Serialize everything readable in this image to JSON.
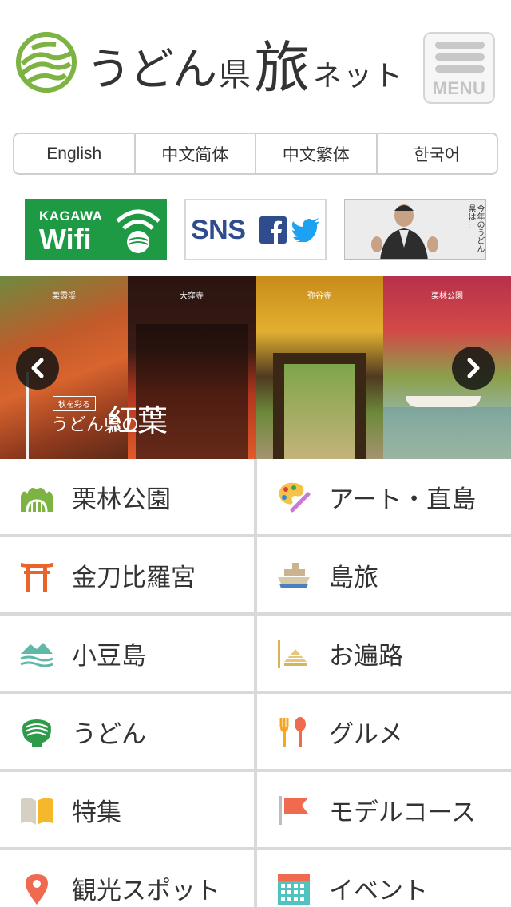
{
  "header": {
    "title_part1": "うどん",
    "title_part2": "県",
    "title_part3": "旅",
    "title_part4": "ネット",
    "menu_label": "MENU"
  },
  "languages": [
    "English",
    "中文简体",
    "中文繁体",
    "한국어"
  ],
  "banners": {
    "wifi_line1": "KAGAWA",
    "wifi_line2": "Wifi",
    "sns_text": "SNS",
    "promo_text": "今年のうどん県は…"
  },
  "slider": {
    "captions": [
      "栗霞渓",
      "大窪寺",
      "弥谷寺",
      "栗林公園"
    ],
    "title_small": "秋を彩る",
    "title_mid": "うどん県の",
    "title_big": "紅葉"
  },
  "menu_items": [
    {
      "label": "栗林公園",
      "icon": "ritsurin-park-icon"
    },
    {
      "label": "アート・直島",
      "icon": "art-palette-icon"
    },
    {
      "label": "金刀比羅宮",
      "icon": "torii-gate-icon"
    },
    {
      "label": "島旅",
      "icon": "ferry-ship-icon"
    },
    {
      "label": "小豆島",
      "icon": "island-waves-icon"
    },
    {
      "label": "お遍路",
      "icon": "pilgrim-hat-icon"
    },
    {
      "label": "うどん",
      "icon": "udon-bowl-icon"
    },
    {
      "label": "グルメ",
      "icon": "fork-spoon-icon"
    },
    {
      "label": "特集",
      "icon": "open-book-icon"
    },
    {
      "label": "モデルコース",
      "icon": "flag-icon"
    },
    {
      "label": "観光スポット",
      "icon": "map-pin-icon"
    },
    {
      "label": "イベント",
      "icon": "calendar-icon"
    }
  ],
  "colors": {
    "logo_green": "#7cb342",
    "wifi_green": "#1e9a45",
    "sns_blue": "#2f4d8c",
    "twitter_blue": "#1da1f2",
    "divider_gray": "#d9d9d9"
  }
}
